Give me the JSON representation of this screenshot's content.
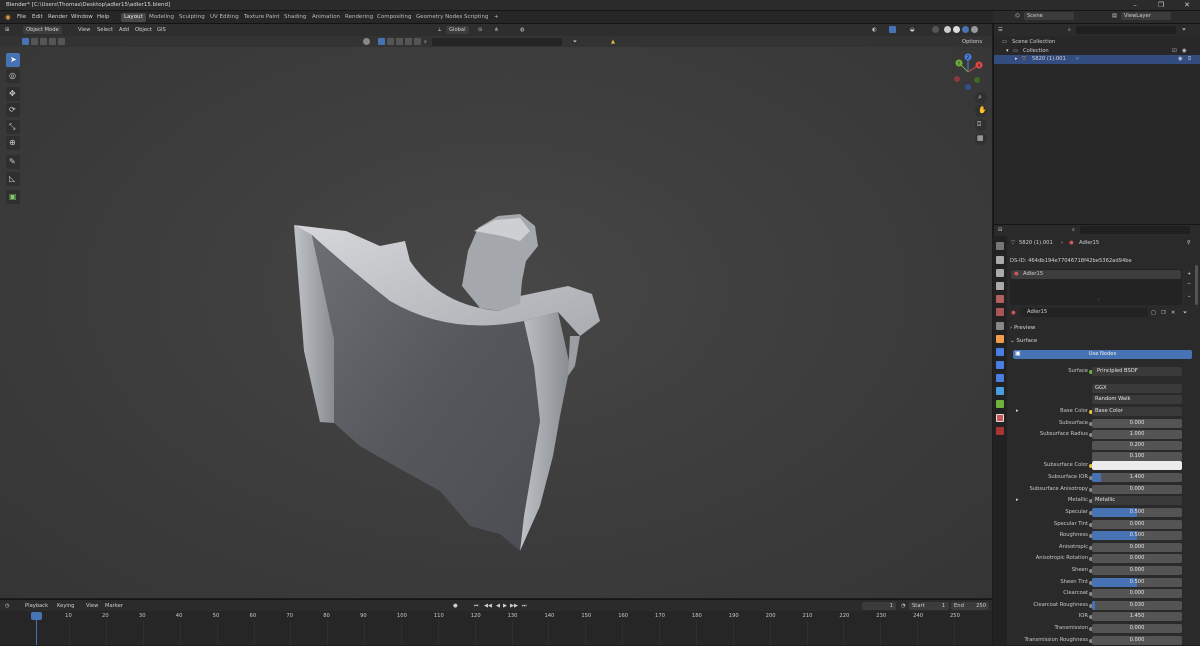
{
  "window": {
    "title": "Blender* [C:\\Users\\Thomas\\Desktop\\adler15\\adler15.blend]",
    "controls": [
      "–",
      "❐",
      "✕"
    ]
  },
  "menu": {
    "items": [
      "File",
      "Edit",
      "Render",
      "Window",
      "Help"
    ]
  },
  "workspaces": [
    "Layout",
    "Modeling",
    "Sculpting",
    "UV Editing",
    "Texture Paint",
    "Shading",
    "Animation",
    "Rendering",
    "Compositing",
    "Geometry Nodes",
    "Scripting"
  ],
  "workspace_add": "+",
  "scene": {
    "name": "Scene",
    "view_layer": "ViewLayer"
  },
  "viewport": {
    "mode": "Object Mode",
    "menus": [
      "View",
      "Select",
      "Add",
      "Object",
      "GIS"
    ],
    "orientation": "Global",
    "options": "Options",
    "gizmo": {
      "x": "X",
      "y": "Y",
      "z": "Z"
    }
  },
  "timeline": {
    "menus": [
      "Playback",
      "Keying",
      "View",
      "Marker"
    ],
    "current_frame": "1",
    "start_label": "Start",
    "start": "1",
    "end_label": "End",
    "end": "250",
    "ticks": [
      "1",
      "10",
      "20",
      "30",
      "40",
      "50",
      "60",
      "70",
      "80",
      "90",
      "100",
      "110",
      "120",
      "130",
      "140",
      "150",
      "160",
      "170",
      "180",
      "190",
      "200",
      "210",
      "220",
      "230",
      "240",
      "250"
    ]
  },
  "outliner": {
    "scene_collection": "Scene Collection",
    "collection": "Collection",
    "object": "5820 (1).001"
  },
  "properties": {
    "breadcrumb_object": "5820 (1).001",
    "breadcrumb_material": "Adler15",
    "ds_id": "DS-ID: 464db194e77046718f42be5362ad94be",
    "slot": "Adler15",
    "material_name": "Adler15",
    "sections": {
      "preview": "Preview",
      "surface": "Surface"
    },
    "use_nodes": "Use Nodes",
    "surface_label": "Surface",
    "surface_value": "Principled BSDF",
    "distribution": "GGX",
    "subsurface_method": "Random Walk",
    "base_color_label": "Base Color",
    "base_color_value": "Base Color",
    "params": [
      {
        "label": "Subsurface",
        "value": "0.000",
        "fill": 0
      },
      {
        "label": "Subsurface Radius",
        "value": "1.000",
        "fill": 0
      },
      {
        "label": "",
        "value": "0.200",
        "fill": 0
      },
      {
        "label": "",
        "value": "0.100",
        "fill": 0
      }
    ],
    "subsurface_color_label": "Subsurface Color",
    "params2": [
      {
        "label": "Subsurface IOR",
        "value": "1.400",
        "fill": 0.1
      },
      {
        "label": "Subsurface Anisotropy",
        "value": "0.000",
        "fill": 0
      }
    ],
    "metallic_label": "Metallic",
    "metallic_value": "Metallic",
    "params3": [
      {
        "label": "Specular",
        "value": "0.500",
        "fill": 0.5
      },
      {
        "label": "Specular Tint",
        "value": "0.000",
        "fill": 0
      },
      {
        "label": "Roughness",
        "value": "0.500",
        "fill": 0.5
      },
      {
        "label": "Anisotropic",
        "value": "0.000",
        "fill": 0
      },
      {
        "label": "Anisotropic Rotation",
        "value": "0.000",
        "fill": 0
      },
      {
        "label": "Sheen",
        "value": "0.000",
        "fill": 0
      },
      {
        "label": "Sheen Tint",
        "value": "0.500",
        "fill": 0.5
      },
      {
        "label": "Clearcoat",
        "value": "0.000",
        "fill": 0
      },
      {
        "label": "Clearcoat Roughness",
        "value": "0.030",
        "fill": 0.03
      },
      {
        "label": "IOR",
        "value": "1.450",
        "fill": 0
      },
      {
        "label": "Transmission",
        "value": "0.000",
        "fill": 0
      },
      {
        "label": "Transmission Roughness",
        "value": "0.000",
        "fill": 0
      }
    ]
  },
  "colors": {
    "accent": "#4772b3",
    "viewport": "#3d3d3d",
    "x_axis": "#e04848",
    "y_axis": "#6fb13b",
    "z_axis": "#4a7ee0"
  }
}
